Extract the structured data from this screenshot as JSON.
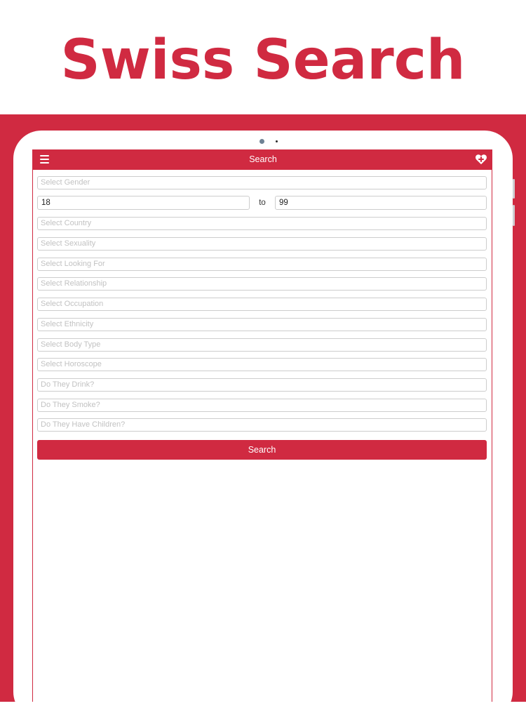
{
  "headline": "Swiss Search",
  "navbar": {
    "title": "Search"
  },
  "form": {
    "gender_placeholder": "Select Gender",
    "age_min": "18",
    "age_to_label": "to",
    "age_max": "99",
    "fields": [
      "Select Country",
      "Select Sexuality",
      "Select Looking For",
      "Select Relationship",
      "Select Occupation",
      "Select Ethnicity",
      "Select Body Type",
      "Select Horoscope",
      "Do They Drink?",
      "Do They Smoke?",
      "Do They Have Children?"
    ],
    "search_button": "Search"
  },
  "colors": {
    "brand": "#d02a41",
    "placeholder": "#c2c2c2",
    "border": "#cdcdcd"
  },
  "icons": {
    "menu": "hamburger-menu-icon",
    "favorite": "heart-plus-icon"
  }
}
